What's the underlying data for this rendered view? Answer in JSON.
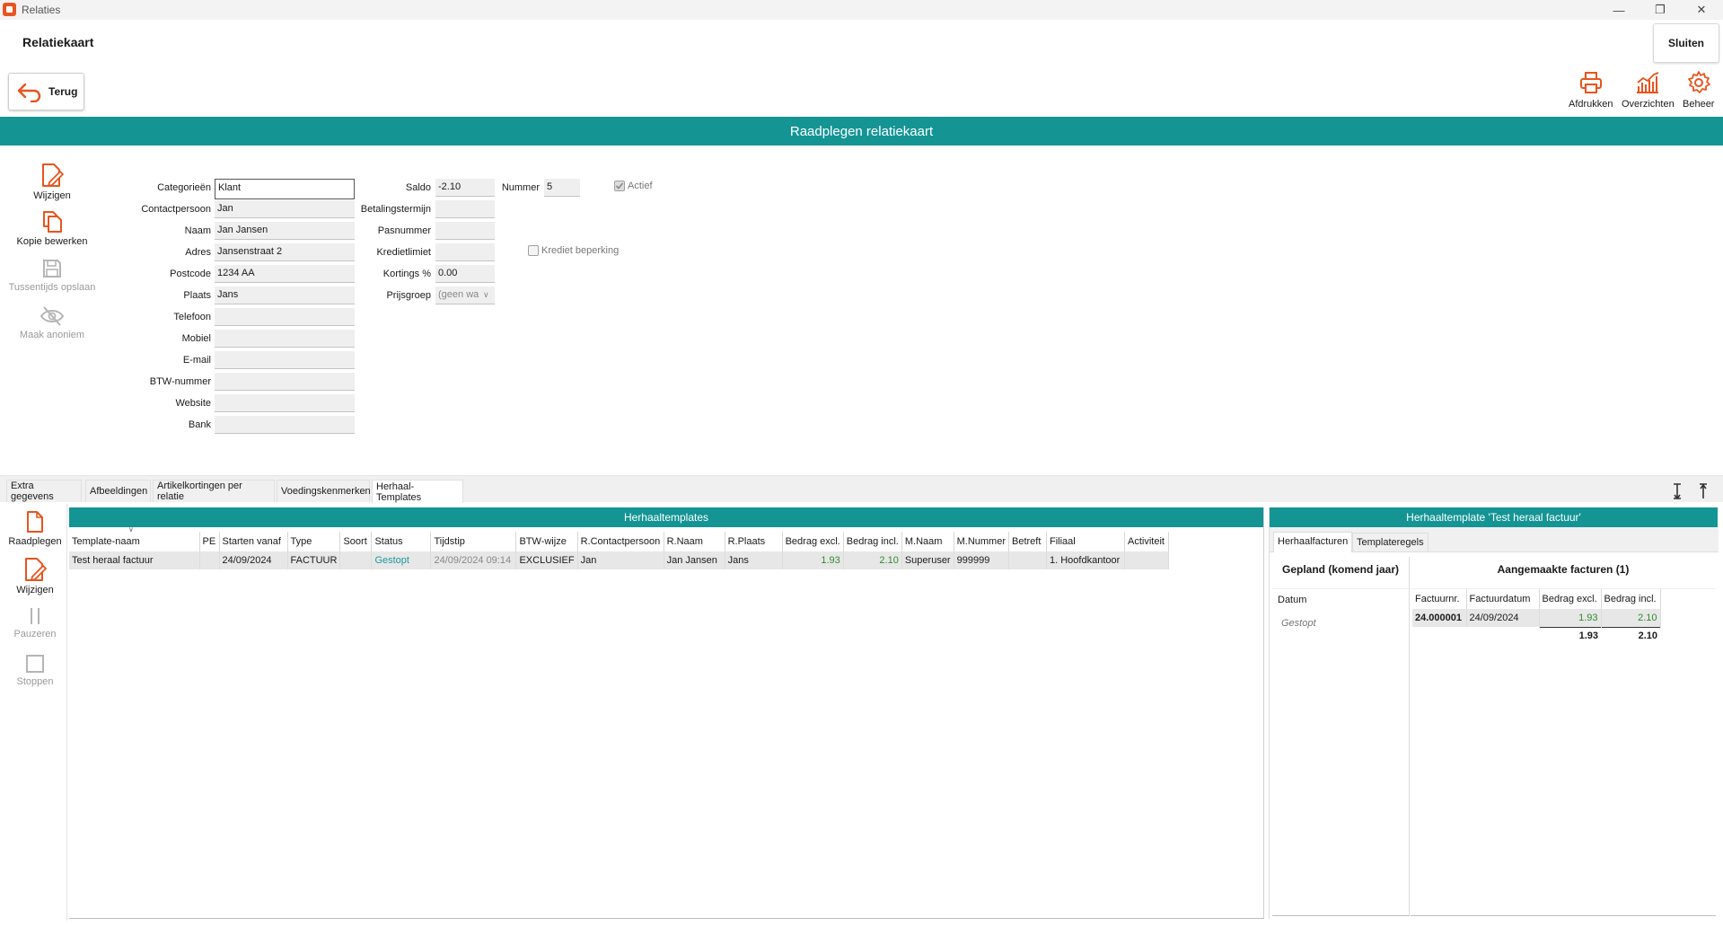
{
  "window": {
    "title": "Relaties"
  },
  "header": {
    "title": "Relatiekaart",
    "close_label": "Sluiten",
    "back_label": "Terug"
  },
  "top_actions": [
    {
      "label": "Afdrukken",
      "icon": "printer-icon"
    },
    {
      "label": "Overzichten",
      "icon": "chart-icon"
    },
    {
      "label": "Beheer",
      "icon": "gear-icon"
    }
  ],
  "banner": "Raadplegen relatiekaart",
  "side_actions": [
    {
      "label": "Wijzigen",
      "icon": "edit-document-icon",
      "enabled": true
    },
    {
      "label": "Kopie bewerken",
      "icon": "copy-document-icon",
      "enabled": true
    },
    {
      "label": "Tussentijds opslaan",
      "icon": "save-icon",
      "enabled": false
    },
    {
      "label": "Maak anoniem",
      "icon": "eye-off-icon",
      "enabled": false
    }
  ],
  "form": {
    "categorieen": {
      "label": "Categorieën",
      "value": "Klant"
    },
    "contactpersoon": {
      "label": "Contactpersoon",
      "value": "Jan"
    },
    "naam": {
      "label": "Naam",
      "value": "Jan Jansen"
    },
    "adres": {
      "label": "Adres",
      "value": "Jansenstraat 2"
    },
    "postcode": {
      "label": "Postcode",
      "value": "1234 AA"
    },
    "plaats": {
      "label": "Plaats",
      "value": "Jans"
    },
    "telefoon": {
      "label": "Telefoon",
      "value": ""
    },
    "mobiel": {
      "label": "Mobiel",
      "value": ""
    },
    "email": {
      "label": "E-mail",
      "value": ""
    },
    "btw": {
      "label": "BTW-nummer",
      "value": ""
    },
    "website": {
      "label": "Website",
      "value": ""
    },
    "bank": {
      "label": "Bank",
      "value": ""
    },
    "saldo": {
      "label": "Saldo",
      "value": "-2.10"
    },
    "betalingstermijn": {
      "label": "Betalingstermijn",
      "value": ""
    },
    "pasnummer": {
      "label": "Pasnummer",
      "value": ""
    },
    "kredietlimiet": {
      "label": "Kredietlimiet",
      "value": ""
    },
    "kortings": {
      "label": "Kortings %",
      "value": "0.00"
    },
    "prijsgroep": {
      "label": "Prijsgroep",
      "value": "(geen wa"
    },
    "nummer": {
      "label": "Nummer",
      "value": "5"
    },
    "actief": {
      "label": "Actief",
      "checked": true
    },
    "krediet": {
      "label": "Krediet beperking",
      "checked": false
    }
  },
  "tabs": [
    {
      "label": "Extra gegevens",
      "active": false
    },
    {
      "label": "Afbeeldingen",
      "active": false
    },
    {
      "label": "Artikelkortingen per relatie",
      "active": false
    },
    {
      "label": "Voedingskenmerken",
      "active": false
    },
    {
      "label": "Herhaal-Templates",
      "active": true
    }
  ],
  "lower_actions": [
    {
      "label": "Raadplegen",
      "icon": "view-document-icon",
      "enabled": true
    },
    {
      "label": "Wijzigen",
      "icon": "edit-document-icon",
      "enabled": true
    },
    {
      "label": "Pauzeren",
      "icon": "pause-icon",
      "enabled": false
    },
    {
      "label": "Stoppen",
      "icon": "stop-icon",
      "enabled": false
    }
  ],
  "templates": {
    "title": "Herhaaltemplates",
    "columns": [
      "Template-naam",
      "PE",
      "Starten vanaf",
      "Type",
      "Soort",
      "Status",
      "Tijdstip",
      "BTW-wijze",
      "R.Contactpersoon",
      "R.Naam",
      "R.Plaats",
      "Bedrag excl.",
      "Bedrag incl.",
      "M.Naam",
      "M.Nummer",
      "Betreft",
      "Filiaal",
      "Activiteit"
    ],
    "rows": [
      {
        "naam": "Test heraal factuur",
        "pe": "",
        "starten": "24/09/2024",
        "type": "FACTUUR",
        "soort": "",
        "status": "Gestopt",
        "tijdstip": "24/09/2024 09:14",
        "btw": "EXCLUSIEF",
        "rcontact": "Jan",
        "rnaam": "Jan Jansen",
        "rplaats": "Jans",
        "excl": "1.93",
        "incl": "2.10",
        "mnaam": "Superuser",
        "mnummer": "999999",
        "betreft": "",
        "filiaal": "1. Hoofdkantoor",
        "activiteit": ""
      }
    ]
  },
  "detail": {
    "title": "Herhaaltemplate 'Test heraal factuur'",
    "tabs": [
      {
        "label": "Herhaalfacturen",
        "active": true
      },
      {
        "label": "Templateregels",
        "active": false
      }
    ],
    "planned_title": "Gepland (komend jaar)",
    "planned_col": "Datum",
    "planned_value": "Gestopt",
    "created_title": "Aangemaakte facturen (1)",
    "created_columns": [
      "Factuurnr.",
      "Factuurdatum",
      "Bedrag excl.",
      "Bedrag incl."
    ],
    "created_rows": [
      {
        "nr": "24.000001",
        "datum": "24/09/2024",
        "excl": "1.93",
        "incl": "2.10"
      }
    ],
    "totals": {
      "excl": "1.93",
      "incl": "2.10"
    }
  },
  "colors": {
    "accent": "#159494",
    "icon": "#e8541e"
  }
}
